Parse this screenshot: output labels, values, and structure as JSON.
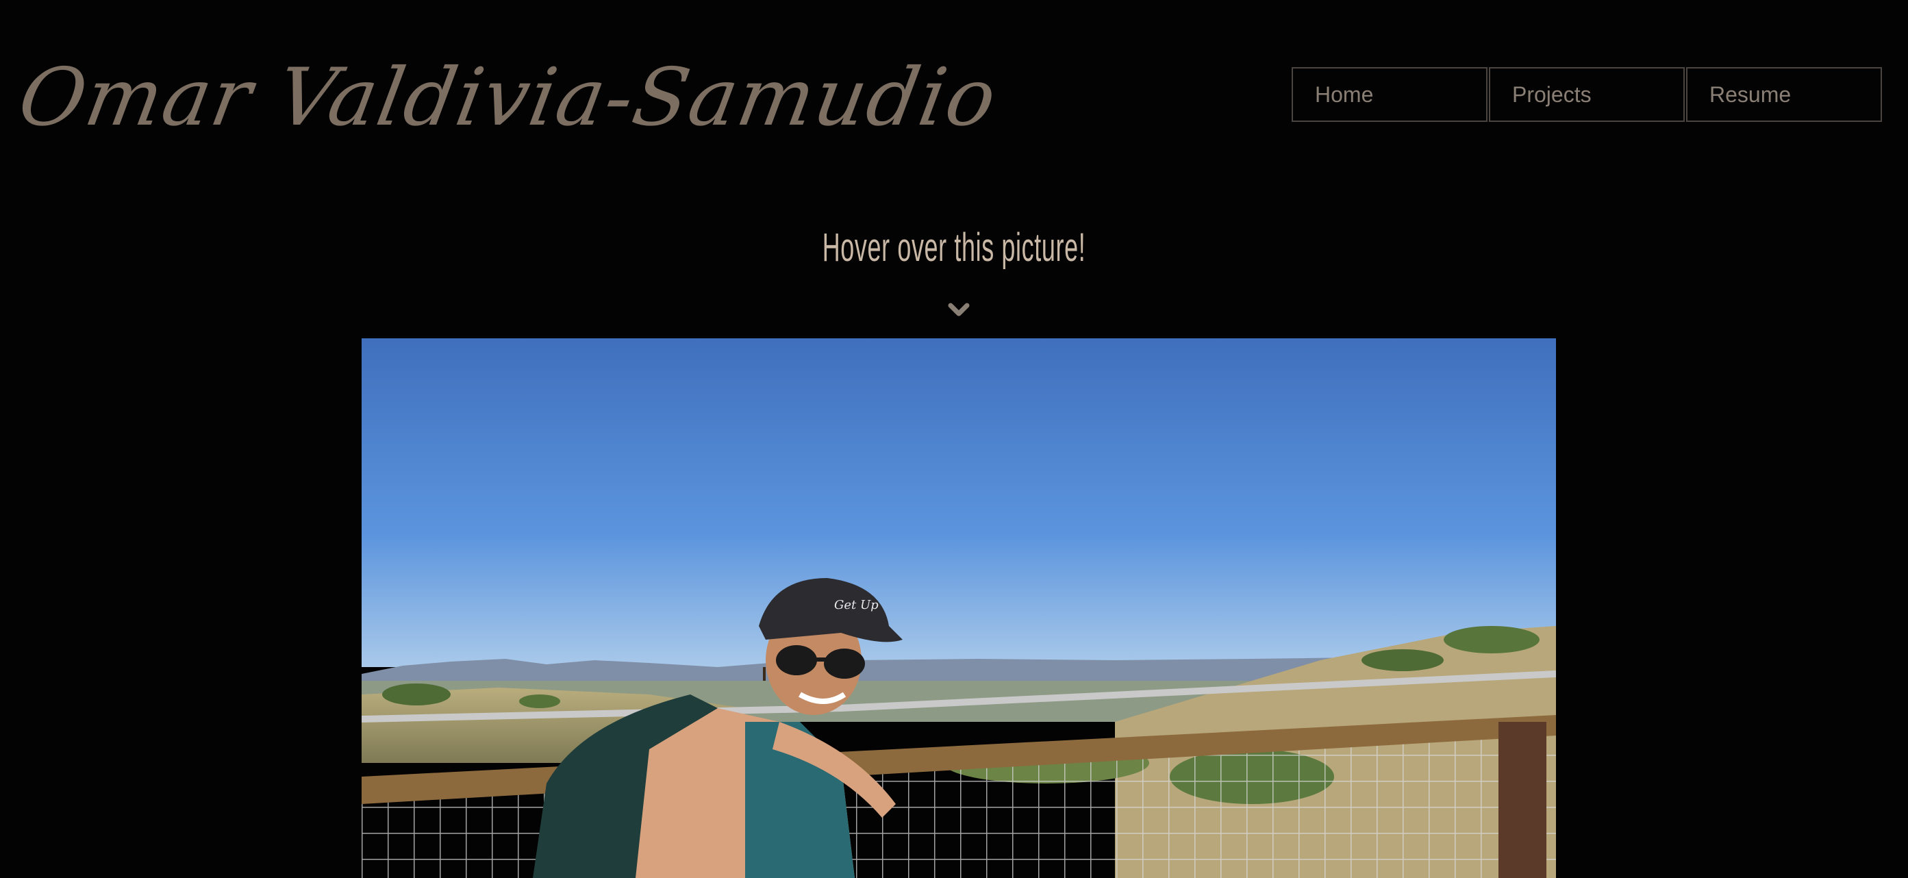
{
  "header": {
    "site_title": "Omar Valdivia-Samudio"
  },
  "nav": {
    "items": [
      {
        "label": "Home"
      },
      {
        "label": "Projects"
      },
      {
        "label": "Resume"
      }
    ]
  },
  "main": {
    "hover_heading": "Hover over this picture!",
    "chevron_icon": "chevron-down-icon",
    "hat_text": "Get Up"
  },
  "colors": {
    "background": "#030303",
    "title": "#7d6e62",
    "nav_text": "#8a7f75",
    "nav_border": "#4a4540",
    "heading": "#c9b8a6"
  }
}
